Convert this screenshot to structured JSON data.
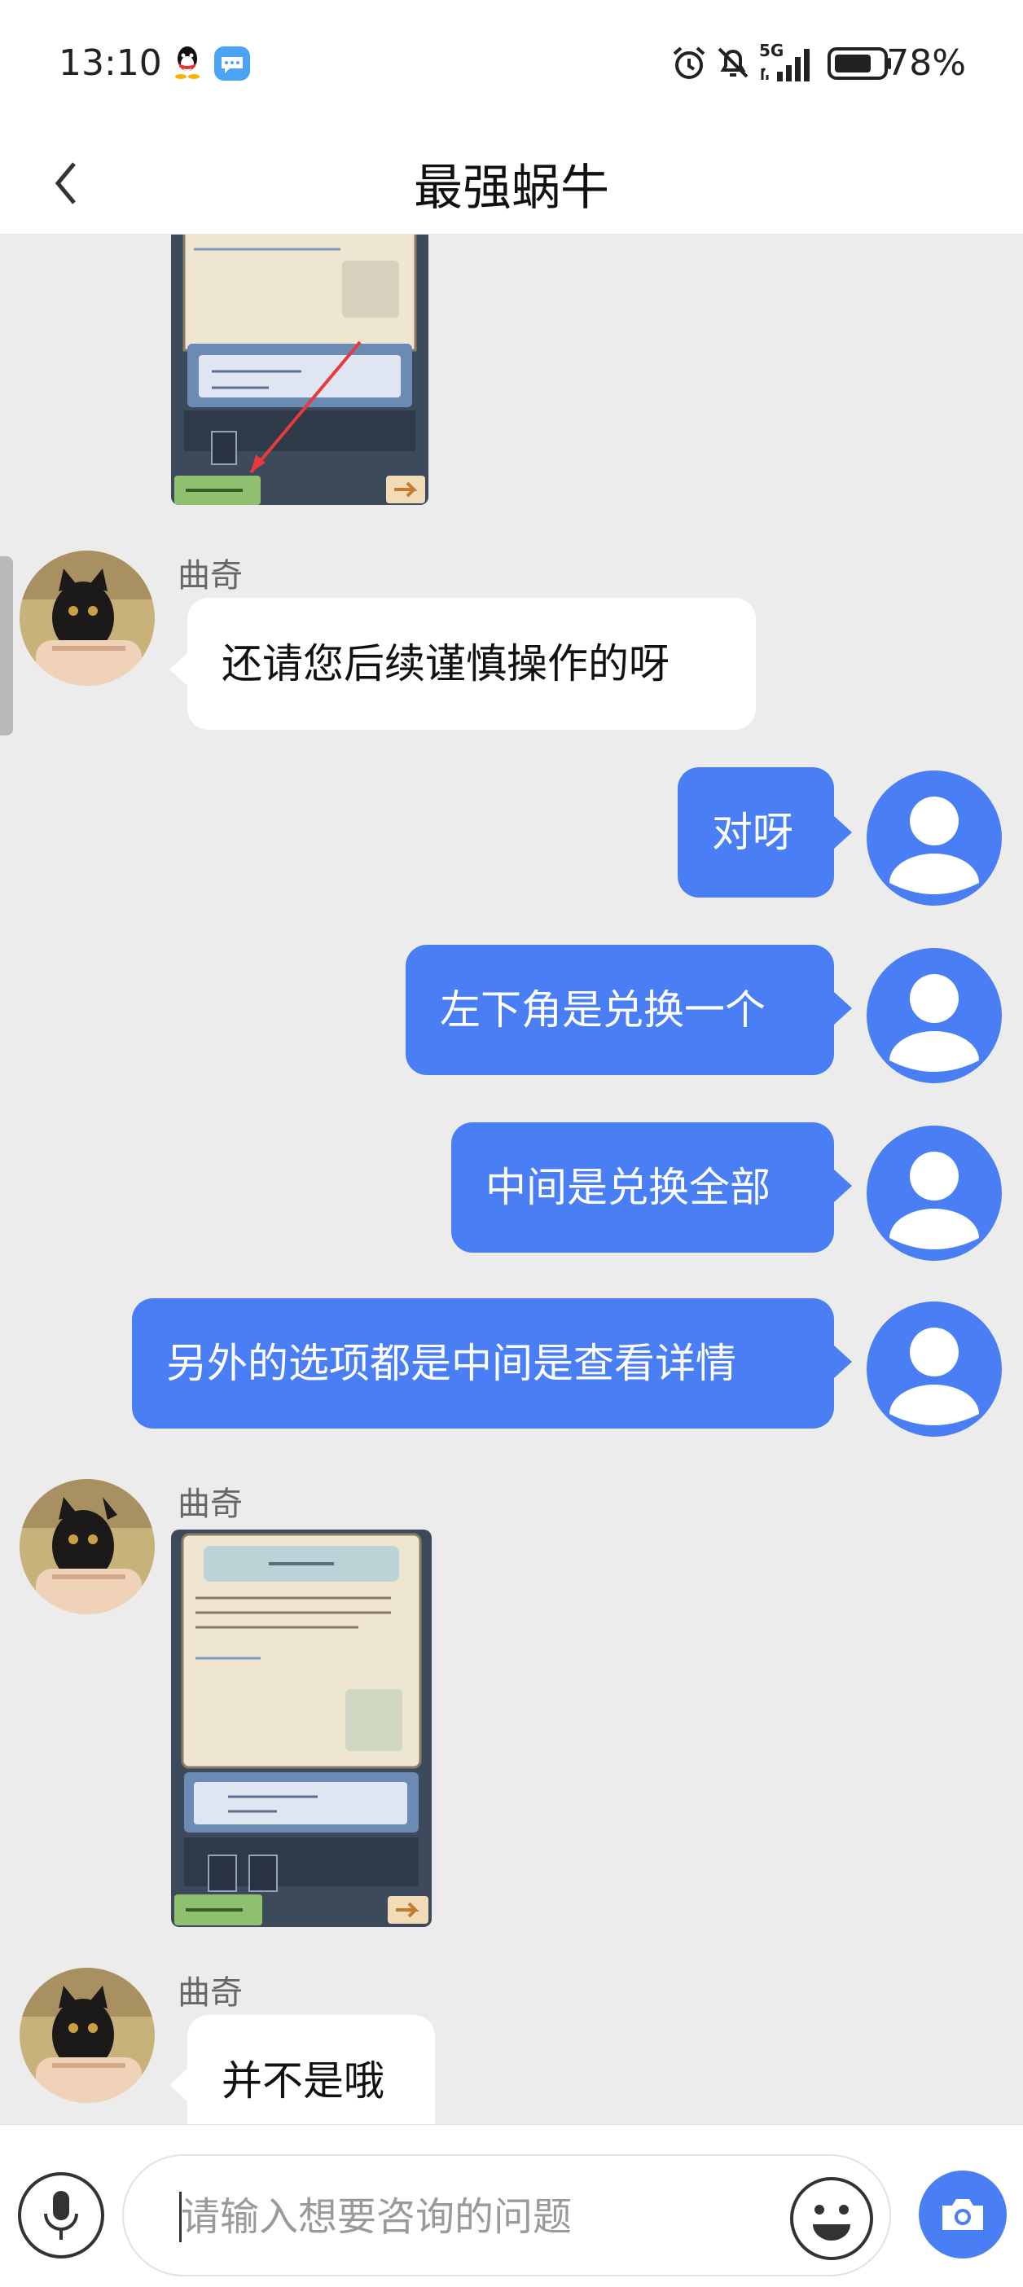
{
  "status_bar": {
    "time": "13:10",
    "network": "5G",
    "battery": "78%",
    "icons": [
      "qq-icon",
      "message-icon",
      "alarm-icon",
      "mute-bell-icon",
      "signal-icon",
      "battery-icon"
    ]
  },
  "header": {
    "title": "最强蜗牛",
    "back_icon": "chevron-left-icon"
  },
  "messages": [
    {
      "side": "in",
      "type": "image",
      "sender": "",
      "content": ""
    },
    {
      "side": "in",
      "type": "text",
      "sender": "曲奇",
      "text": "还请您后续谨慎操作的呀"
    },
    {
      "side": "out",
      "type": "text",
      "text": "对呀"
    },
    {
      "side": "out",
      "type": "text",
      "text": "左下角是兑换一个"
    },
    {
      "side": "out",
      "type": "text",
      "text": "中间是兑换全部"
    },
    {
      "side": "out",
      "type": "text",
      "text": "另外的选项都是中间是查看详情"
    },
    {
      "side": "in",
      "type": "image",
      "sender": "曲奇",
      "content": ""
    },
    {
      "side": "in",
      "type": "text",
      "sender": "曲奇",
      "text": "并不是哦"
    }
  ],
  "input_bar": {
    "placeholder": "请输入想要咨询的问题",
    "mic_icon": "microphone-icon",
    "emoji_icon": "emoji-icon",
    "camera_icon": "camera-icon"
  },
  "colors": {
    "accent": "#4a7ef5",
    "chat_background": "#ececec",
    "incoming_bubble": "#ffffff"
  }
}
